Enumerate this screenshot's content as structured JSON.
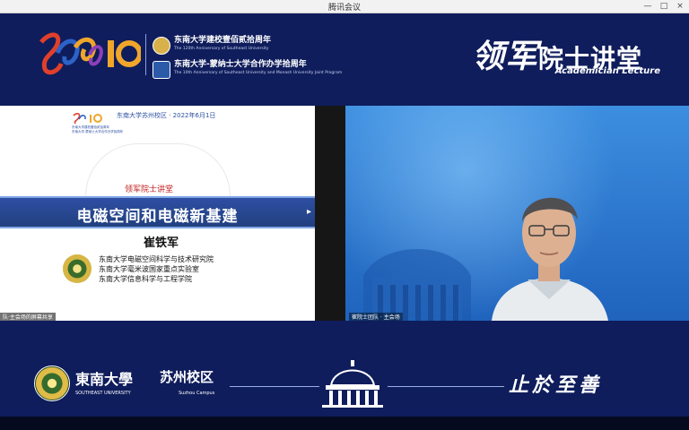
{
  "window": {
    "title": "腾讯会议",
    "controls": [
      "—",
      "□",
      "×"
    ]
  },
  "banner": {
    "anniv_line1_cn": "东南大学建校壹佰贰拾周年",
    "anniv_line1_en": "The 120th Anniversary of Southeast University",
    "anniv_line2_cn": "东南大学-蒙纳士大学合作办学拾周年",
    "anniv_line2_en": "The 10th Anniversary of Southeast University and Monash University Joint Program",
    "lecture_cn_a": "领军",
    "lecture_cn_b": "院士讲堂",
    "lecture_en": "Academician Lecture"
  },
  "shared_screen": {
    "top_line": "东南大学苏州校区 · 2022年6月1日",
    "sub_lines": [
      "东南大学建校壹佰贰拾周年",
      "东南大学-蒙纳士大学合作办学拾周年"
    ],
    "tag": "领军院士讲堂",
    "title": "电磁空间和电磁新基建",
    "speaker": "崔铁军",
    "affiliations": [
      "东南大学电磁空间科学与技术研究院",
      "东南大学毫米波国家重点实验室",
      "东南大学信息科学与工程学院"
    ],
    "share_label": "队·主会场的屏幕共享"
  },
  "video": {
    "participant_label": "崔院士团队 · 主会场"
  },
  "footer": {
    "school_cn": "東南大學",
    "school_en": "SOUTHEAST UNIVERSITY",
    "campus_cn": "苏州校区",
    "campus_en": "Suzhou Campus",
    "motto": "止於至善"
  },
  "colors": {
    "banner_bg": "#0f1d5c",
    "slide_bar": "#2e4fa3",
    "video_bg": "#2a7ad4",
    "accent_red": "#c02020"
  }
}
